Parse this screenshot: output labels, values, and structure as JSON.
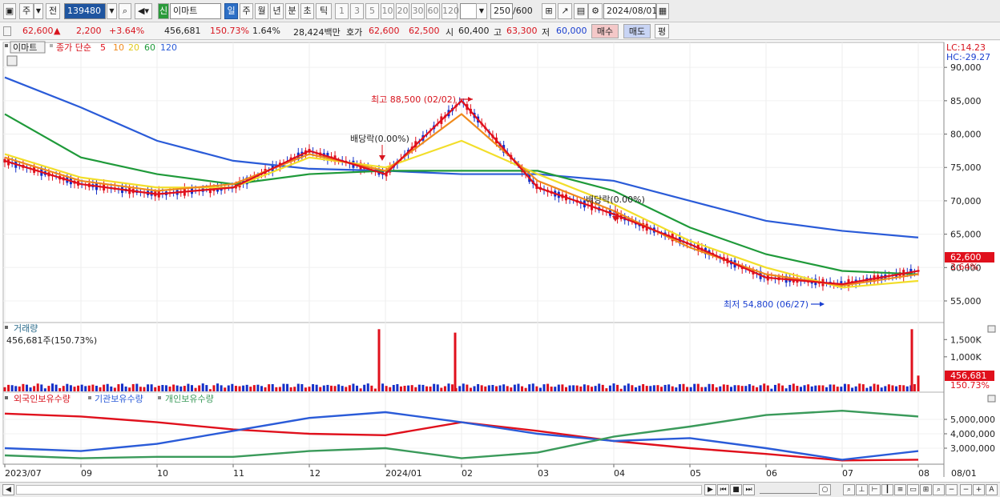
{
  "toolbar": {
    "market_label": "주",
    "prev_label": "전",
    "code_value": "139480",
    "badge_label": "신",
    "stock_name": "이마트",
    "period_day": "일",
    "period_week": "주",
    "period_month": "월",
    "period_year": "년",
    "period_min": "분",
    "period_sec": "초",
    "period_tick": "틱",
    "intervals": [
      "1",
      "3",
      "5",
      "10",
      "20",
      "30",
      "60",
      "120"
    ],
    "count_value": "250",
    "count_total": "/600",
    "date_value": "2024/08/01"
  },
  "quote": {
    "price": "62,600",
    "change_arrow": "▲",
    "change": "2,200",
    "change_pct": "+3.64%",
    "volume": "456,681",
    "volume_ratio": "150.73%",
    "turnover_pct": "1.64%",
    "trade_value": "28,424백만",
    "ask_label": "호가",
    "ask_value": "62,600",
    "bid_value": "62,500",
    "open_label": "시",
    "open_value": "60,400",
    "high_label": "고",
    "high_value": "63,300",
    "low_label": "저",
    "low_value": "60,000",
    "buy_label": "매수",
    "sell_label": "매도",
    "eval_label": "평"
  },
  "price_panel": {
    "name": "이마트",
    "legend_prefix": "종가 단순",
    "ma_labels": [
      "5",
      "10",
      "20",
      "60",
      "120"
    ],
    "lc_label": "LC:14.23",
    "hc_label": "HC:-29.27",
    "y_ticks": [
      "90,000",
      "85,000",
      "80,000",
      "75,000",
      "70,000",
      "65,000",
      "60,000",
      "55,000"
    ],
    "last_price_label": "62,600",
    "last_pct_label": "3.64%",
    "high_annotation": "최고 88,500 (02/02)",
    "low_annotation": "최저 54,800 (06/27)",
    "dividend1": "배당락(0.00%)",
    "dividend2": "배당락(0.00%)"
  },
  "volume_panel": {
    "title": "거래량",
    "value_label": "456,681주(150.73%)",
    "y_ticks": [
      "1,500K",
      "1,000K"
    ],
    "last_label": "456,681",
    "last_pct": "150.73%"
  },
  "holdings_panel": {
    "legend_foreign": "외국인보유수량",
    "legend_inst": "기관보유수량",
    "legend_indiv": "개인보유수량",
    "y_ticks": [
      "5,000,000",
      "4,000,000",
      "3,000,000"
    ]
  },
  "x_axis": {
    "labels": [
      "2023/07",
      "09",
      "10",
      "11",
      "12",
      "2024/01",
      "02",
      "03",
      "04",
      "05",
      "06",
      "07",
      "08",
      "08/01"
    ]
  },
  "colors": {
    "up": "#e0101c",
    "down": "#1530c8",
    "ma5": "#e0101c",
    "ma10": "#f08a1c",
    "ma20": "#f2de2a",
    "ma60": "#1f9a3a",
    "ma120": "#2a5bd8",
    "foreign": "#e0101c",
    "inst": "#2a5bd8",
    "indiv": "#3a9a5a"
  },
  "chart_data": [
    {
      "type": "line",
      "title": "이마트",
      "x": [
        "2023/07",
        "09",
        "10",
        "11",
        "12",
        "2024/01",
        "02",
        "03",
        "04",
        "05",
        "06",
        "07",
        "08"
      ],
      "series": [
        {
          "name": "5",
          "values": [
            76000,
            72500,
            71000,
            72000,
            77500,
            74000,
            85000,
            72000,
            68000,
            63500,
            58500,
            57500,
            59500
          ]
        },
        {
          "name": "10",
          "values": [
            76500,
            73000,
            71500,
            72500,
            77000,
            74500,
            83000,
            73000,
            68500,
            63000,
            59000,
            57300,
            59000
          ]
        },
        {
          "name": "20",
          "values": [
            77000,
            73500,
            72000,
            72000,
            76500,
            75000,
            79000,
            74000,
            69500,
            64000,
            60000,
            57000,
            58000
          ]
        },
        {
          "name": "60",
          "values": [
            83000,
            76500,
            74000,
            72500,
            74000,
            74500,
            74500,
            74500,
            71500,
            66000,
            62000,
            59500,
            59000
          ]
        },
        {
          "name": "120",
          "values": [
            88500,
            84000,
            79000,
            76000,
            74800,
            74500,
            74000,
            74000,
            73000,
            70000,
            67000,
            65500,
            64500
          ]
        }
      ],
      "ylim": [
        52000,
        93500
      ],
      "annotations": [
        "최고 88,500 (02/02)",
        "최저 54,800 (06/27)"
      ]
    },
    {
      "type": "bar",
      "title": "거래량",
      "last_value": 456681,
      "spikes": [
        {
          "x": "08",
          "value": 1800000
        },
        {
          "x": "2024/01",
          "value": 1800000
        },
        {
          "x": "02",
          "value": 1700000
        }
      ],
      "ylim": [
        0,
        1900000
      ]
    },
    {
      "type": "line",
      "title": "보유수량",
      "x": [
        "2023/07",
        "09",
        "10",
        "11",
        "12",
        "2024/01",
        "02",
        "03",
        "04",
        "05",
        "06",
        "07",
        "08"
      ],
      "series": [
        {
          "name": "외국인보유수량",
          "values": [
            5400000,
            5200000,
            4800000,
            4300000,
            4000000,
            3900000,
            4800000,
            4200000,
            3500000,
            3000000,
            2600000,
            2150000,
            2200000
          ]
        },
        {
          "name": "기관보유수량",
          "values": [
            3000000,
            2800000,
            3300000,
            4200000,
            5100000,
            5500000,
            4800000,
            4000000,
            3500000,
            3700000,
            3000000,
            2200000,
            2800000
          ]
        },
        {
          "name": "개인보유수량",
          "values": [
            2500000,
            2300000,
            2400000,
            2400000,
            2800000,
            3000000,
            2300000,
            2700000,
            3800000,
            4500000,
            5300000,
            5600000,
            5200000
          ]
        }
      ],
      "ylim": [
        2000000,
        6000000
      ]
    }
  ]
}
